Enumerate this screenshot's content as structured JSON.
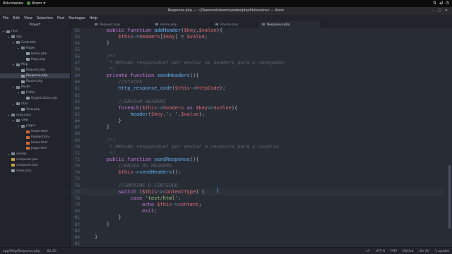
{
  "topbar": {
    "activities": "Atividades",
    "app_name": "Atom",
    "app_menu_arrow": "▾",
    "clock": "",
    "tray_icons": [
      "network-icon",
      "volume-icon",
      "power-icon"
    ]
  },
  "window": {
    "title": "Response.php — ~/Desenvolvimento/wdev/php/htdocs/mvc — Atom",
    "buttons": [
      "–",
      "□",
      "✕"
    ]
  },
  "menu": [
    "File",
    "Edit",
    "View",
    "Selection",
    "Find",
    "Packages",
    "Help"
  ],
  "tabs": [
    {
      "label": "Project",
      "kind": "project"
    },
    {
      "label": "Request.php",
      "kind": "file"
    },
    {
      "label": "Home.php",
      "kind": "file"
    },
    {
      "label": "Router.php",
      "kind": "file"
    },
    {
      "label": "Response.php",
      "kind": "file",
      "active": true
    }
  ],
  "tree": [
    {
      "label": "mvc",
      "type": "folder",
      "depth": 0,
      "open": true
    },
    {
      "label": "app",
      "type": "folder",
      "depth": 1,
      "open": true
    },
    {
      "label": "Controller",
      "type": "folder",
      "depth": 2,
      "open": true
    },
    {
      "label": "Pages",
      "type": "folder",
      "depth": 3,
      "open": true
    },
    {
      "label": "Home.php",
      "type": "php",
      "depth": 4
    },
    {
      "label": "Page.php",
      "type": "php",
      "depth": 4
    },
    {
      "label": "Http",
      "type": "folder",
      "depth": 2,
      "open": true
    },
    {
      "label": "Request.php",
      "type": "php",
      "depth": 3
    },
    {
      "label": "Response.php",
      "type": "php",
      "depth": 3,
      "selected": true
    },
    {
      "label": "Router.php",
      "type": "php",
      "depth": 3
    },
    {
      "label": "Model",
      "type": "folder",
      "depth": 2,
      "open": true
    },
    {
      "label": "Entity",
      "type": "folder",
      "depth": 3,
      "open": true
    },
    {
      "label": "Organization.php",
      "type": "php",
      "depth": 4
    },
    {
      "label": "Utils",
      "type": "folder",
      "depth": 2,
      "open": true
    },
    {
      "label": "View.php",
      "type": "php",
      "depth": 3
    },
    {
      "label": "resources",
      "type": "folder",
      "depth": 1,
      "open": true
    },
    {
      "label": "view",
      "type": "folder",
      "depth": 2,
      "open": true
    },
    {
      "label": "pages",
      "type": "folder",
      "depth": 3,
      "open": true
    },
    {
      "label": "footer.html",
      "type": "html",
      "depth": 4
    },
    {
      "label": "header.html",
      "type": "html",
      "depth": 4
    },
    {
      "label": "home.html",
      "type": "html",
      "depth": 4
    },
    {
      "label": "page.html",
      "type": "html",
      "depth": 4
    },
    {
      "label": "vendor",
      "type": "folder",
      "depth": 1,
      "open": false
    },
    {
      "label": "composer.json",
      "type": "json",
      "depth": 1
    },
    {
      "label": "composer.lock",
      "type": "json",
      "depth": 1
    },
    {
      "label": "index.php",
      "type": "php",
      "depth": 1
    }
  ],
  "code_lines": [
    {
      "n": "52",
      "indent": 1,
      "tokens": [
        [
          "kw",
          "public "
        ],
        [
          "kw",
          "function "
        ],
        [
          "fn",
          "addHeader"
        ],
        [
          "pn",
          "("
        ],
        [
          "var",
          "$key"
        ],
        [
          "pn",
          ","
        ],
        [
          "var",
          "$value"
        ],
        [
          "pn",
          "){"
        ]
      ]
    },
    {
      "n": "53",
      "indent": 2,
      "tokens": [
        [
          "var",
          "$this"
        ],
        [
          "op",
          "->"
        ],
        [
          "var",
          "headers"
        ],
        [
          "pn",
          "["
        ],
        [
          "var",
          "$key"
        ],
        [
          "pn",
          "] = "
        ],
        [
          "var",
          "$value"
        ],
        [
          "pn",
          ";"
        ]
      ]
    },
    {
      "n": "54",
      "indent": 1,
      "tokens": [
        [
          "pn",
          "}"
        ]
      ]
    },
    {
      "n": "55",
      "indent": 0,
      "tokens": []
    },
    {
      "n": "56",
      "indent": 1,
      "tokens": [
        [
          "cmt",
          "/**"
        ]
      ]
    },
    {
      "n": "57",
      "indent": 1,
      "tokens": [
        [
          "cmt",
          " * Método responsável por enviar os headers para o navegador"
        ]
      ]
    },
    {
      "n": "58",
      "indent": 1,
      "tokens": [
        [
          "cmt",
          " */"
        ]
      ]
    },
    {
      "n": "59",
      "indent": 1,
      "tokens": [
        [
          "kw",
          "private "
        ],
        [
          "kw",
          "function "
        ],
        [
          "fn",
          "sendHeaders"
        ],
        [
          "pn",
          "(){"
        ]
      ]
    },
    {
      "n": "60",
      "indent": 2,
      "tokens": [
        [
          "cmt",
          "//STATUS"
        ]
      ]
    },
    {
      "n": "61",
      "indent": 2,
      "tokens": [
        [
          "fn",
          "http_response_code"
        ],
        [
          "pn",
          "("
        ],
        [
          "var",
          "$this"
        ],
        [
          "op",
          "->"
        ],
        [
          "var",
          "httpCode"
        ],
        [
          "pn",
          ");"
        ]
      ]
    },
    {
      "n": "62",
      "indent": 0,
      "tokens": []
    },
    {
      "n": "63",
      "indent": 2,
      "tokens": [
        [
          "cmt",
          "//ENVIAR HEADERS"
        ]
      ]
    },
    {
      "n": "64",
      "indent": 2,
      "tokens": [
        [
          "kw",
          "foreach"
        ],
        [
          "pn",
          "("
        ],
        [
          "var",
          "$this"
        ],
        [
          "op",
          "->"
        ],
        [
          "var",
          "headers"
        ],
        [
          "kw",
          " as "
        ],
        [
          "var",
          "$key"
        ],
        [
          "op",
          "=>"
        ],
        [
          "var",
          "$value"
        ],
        [
          "pn",
          "){"
        ]
      ]
    },
    {
      "n": "65",
      "indent": 3,
      "tokens": [
        [
          "fn",
          "header"
        ],
        [
          "pn",
          "("
        ],
        [
          "var",
          "$key"
        ],
        [
          "pn",
          "."
        ],
        [
          "str",
          "': '"
        ],
        [
          "pn",
          "."
        ],
        [
          "var",
          "$value"
        ],
        [
          "pn",
          ");"
        ]
      ]
    },
    {
      "n": "66",
      "indent": 2,
      "tokens": [
        [
          "pn",
          "}"
        ]
      ]
    },
    {
      "n": "67",
      "indent": 1,
      "tokens": [
        [
          "pn",
          "}"
        ]
      ]
    },
    {
      "n": "68",
      "indent": 0,
      "tokens": []
    },
    {
      "n": "69",
      "indent": 1,
      "tokens": [
        [
          "cmt",
          "/**"
        ]
      ]
    },
    {
      "n": "70",
      "indent": 1,
      "tokens": [
        [
          "cmt",
          " * Método responsável por enviar a resposta para o usuário"
        ]
      ]
    },
    {
      "n": "71",
      "indent": 1,
      "tokens": [
        [
          "cmt",
          " */"
        ]
      ]
    },
    {
      "n": "72",
      "indent": 1,
      "tokens": [
        [
          "kw",
          "public "
        ],
        [
          "kw",
          "function "
        ],
        [
          "fn",
          "sendResponse"
        ],
        [
          "pn",
          "(){"
        ]
      ]
    },
    {
      "n": "73",
      "indent": 2,
      "tokens": [
        [
          "cmt",
          "//ENVIA OS HEADERS"
        ]
      ]
    },
    {
      "n": "74",
      "indent": 2,
      "tokens": [
        [
          "var",
          "$this"
        ],
        [
          "op",
          "->"
        ],
        [
          "fn",
          "sendHeaders"
        ],
        [
          "pn",
          "();"
        ]
      ]
    },
    {
      "n": "75",
      "indent": 0,
      "tokens": []
    },
    {
      "n": "76",
      "indent": 2,
      "tokens": [
        [
          "cmt",
          "//IMPRIME O CONTEÚDO"
        ]
      ]
    },
    {
      "n": "77",
      "indent": 2,
      "cursor": true,
      "tokens": [
        [
          "kw",
          "switch "
        ],
        [
          "pn",
          "("
        ],
        [
          "var",
          "$this"
        ],
        [
          "op",
          "->"
        ],
        [
          "var",
          "contentType"
        ],
        [
          "pn",
          ") {"
        ]
      ]
    },
    {
      "n": "78",
      "indent": 3,
      "tokens": [
        [
          "kw",
          "case "
        ],
        [
          "str",
          "'text/html'"
        ],
        [
          "pn",
          ":"
        ]
      ]
    },
    {
      "n": "79",
      "indent": 4,
      "tokens": [
        [
          "kw",
          "echo "
        ],
        [
          "var",
          "$this"
        ],
        [
          "op",
          "->"
        ],
        [
          "var",
          "content"
        ],
        [
          "pn",
          ";"
        ]
      ]
    },
    {
      "n": "80",
      "indent": 4,
      "tokens": [
        [
          "kw",
          "exit"
        ],
        [
          "pn",
          ";"
        ]
      ]
    },
    {
      "n": "81",
      "indent": 2,
      "tokens": [
        [
          "pn",
          "}"
        ]
      ]
    },
    {
      "n": "82",
      "indent": 1,
      "tokens": [
        [
          "pn",
          "}"
        ]
      ]
    },
    {
      "n": "83",
      "indent": 0,
      "tokens": []
    },
    {
      "n": "84",
      "indent": 0,
      "tokens": [
        [
          "pn",
          "}"
        ]
      ]
    },
    {
      "n": "85",
      "indent": 0,
      "tokens": []
    }
  ],
  "status": {
    "path": "app/Http/Response.php",
    "cursor_pos": "82:20",
    "line_ending": "LF",
    "encoding": "UTF-8",
    "grammar": "PHP",
    "github": "GitHub",
    "git": "Git (0)",
    "updates": "1 update"
  }
}
